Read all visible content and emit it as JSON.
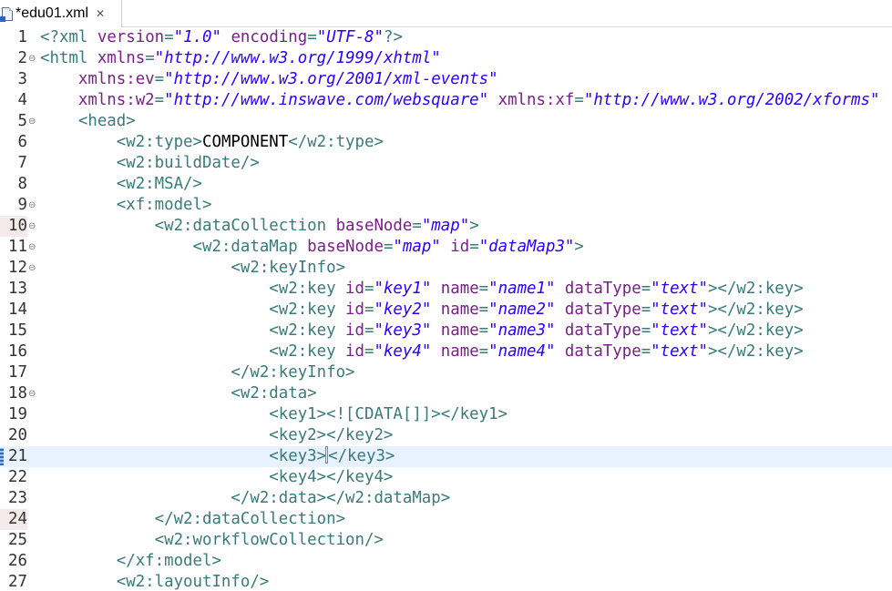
{
  "tab": {
    "title": "*edu01.xml",
    "close_glyph": "✕",
    "icon": "xml-file-icon"
  },
  "editor": {
    "current_line": 21,
    "lines": [
      {
        "n": "1",
        "fold": "",
        "parts": [
          [
            "t",
            "<?"
          ],
          [
            "t",
            "xml "
          ],
          [
            "a",
            "version"
          ],
          [
            "p",
            "="
          ],
          [
            "v",
            "\"1.0\""
          ],
          [
            "a",
            " encoding"
          ],
          [
            "p",
            "="
          ],
          [
            "v",
            "\"UTF-8\""
          ],
          [
            "t",
            "?>"
          ]
        ]
      },
      {
        "n": "2",
        "fold": "⊖",
        "parts": [
          [
            "t",
            "<html "
          ],
          [
            "a",
            "xmlns"
          ],
          [
            "p",
            "="
          ],
          [
            "v",
            "\"http://www.w3.org/1999/xhtml\""
          ]
        ]
      },
      {
        "n": "3",
        "fold": "",
        "parts": [
          [
            "x",
            "    "
          ],
          [
            "a",
            "xmlns:ev"
          ],
          [
            "p",
            "="
          ],
          [
            "v",
            "\"http://www.w3.org/2001/xml-events\""
          ]
        ]
      },
      {
        "n": "4",
        "fold": "",
        "parts": [
          [
            "x",
            "    "
          ],
          [
            "a",
            "xmlns:w2"
          ],
          [
            "p",
            "="
          ],
          [
            "v",
            "\"http://www.inswave.com/websquare\""
          ],
          [
            "a",
            " xmlns:xf"
          ],
          [
            "p",
            "="
          ],
          [
            "v",
            "\"http://www.w3.org/2002/xforms\""
          ]
        ]
      },
      {
        "n": "5",
        "fold": "⊖",
        "parts": [
          [
            "x",
            "    "
          ],
          [
            "t",
            "<head>"
          ]
        ]
      },
      {
        "n": "6",
        "fold": "",
        "parts": [
          [
            "x",
            "        "
          ],
          [
            "t",
            "<w2:type>"
          ],
          [
            "x",
            "COMPONENT"
          ],
          [
            "t",
            "</w2:type>"
          ]
        ]
      },
      {
        "n": "7",
        "fold": "",
        "parts": [
          [
            "x",
            "        "
          ],
          [
            "t",
            "<w2:buildDate/>"
          ]
        ]
      },
      {
        "n": "8",
        "fold": "",
        "parts": [
          [
            "x",
            "        "
          ],
          [
            "t",
            "<w2:MSA/>"
          ]
        ]
      },
      {
        "n": "9",
        "fold": "⊖",
        "parts": [
          [
            "x",
            "        "
          ],
          [
            "t",
            "<xf:model>"
          ]
        ]
      },
      {
        "n": "10",
        "fold": "⊖",
        "err": true,
        "parts": [
          [
            "x",
            "            "
          ],
          [
            "t",
            "<w2:dataCollection "
          ],
          [
            "a",
            "baseNode"
          ],
          [
            "p",
            "="
          ],
          [
            "v",
            "\"map\""
          ],
          [
            "t",
            ">"
          ]
        ]
      },
      {
        "n": "11",
        "fold": "⊖",
        "parts": [
          [
            "x",
            "                "
          ],
          [
            "t",
            "<w2:dataMap "
          ],
          [
            "a",
            "baseNode"
          ],
          [
            "p",
            "="
          ],
          [
            "v",
            "\"map\""
          ],
          [
            "a",
            " id"
          ],
          [
            "p",
            "="
          ],
          [
            "v",
            "\"dataMap3\""
          ],
          [
            "t",
            ">"
          ]
        ]
      },
      {
        "n": "12",
        "fold": "⊖",
        "parts": [
          [
            "x",
            "                    "
          ],
          [
            "t",
            "<w2:keyInfo>"
          ]
        ]
      },
      {
        "n": "13",
        "fold": "",
        "parts": [
          [
            "x",
            "                        "
          ],
          [
            "t",
            "<w2:key "
          ],
          [
            "a",
            "id"
          ],
          [
            "p",
            "="
          ],
          [
            "v",
            "\"key1\""
          ],
          [
            "a",
            " name"
          ],
          [
            "p",
            "="
          ],
          [
            "v",
            "\"name1\""
          ],
          [
            "a",
            " dataType"
          ],
          [
            "p",
            "="
          ],
          [
            "v",
            "\"text\""
          ],
          [
            "t",
            "></w2:key>"
          ]
        ]
      },
      {
        "n": "14",
        "fold": "",
        "parts": [
          [
            "x",
            "                        "
          ],
          [
            "t",
            "<w2:key "
          ],
          [
            "a",
            "id"
          ],
          [
            "p",
            "="
          ],
          [
            "v",
            "\"key2\""
          ],
          [
            "a",
            " name"
          ],
          [
            "p",
            "="
          ],
          [
            "v",
            "\"name2\""
          ],
          [
            "a",
            " dataType"
          ],
          [
            "p",
            "="
          ],
          [
            "v",
            "\"text\""
          ],
          [
            "t",
            "></w2:key>"
          ]
        ]
      },
      {
        "n": "15",
        "fold": "",
        "parts": [
          [
            "x",
            "                        "
          ],
          [
            "t",
            "<w2:key "
          ],
          [
            "a",
            "id"
          ],
          [
            "p",
            "="
          ],
          [
            "v",
            "\"key3\""
          ],
          [
            "a",
            " name"
          ],
          [
            "p",
            "="
          ],
          [
            "v",
            "\"name3\""
          ],
          [
            "a",
            " dataType"
          ],
          [
            "p",
            "="
          ],
          [
            "v",
            "\"text\""
          ],
          [
            "t",
            "></w2:key>"
          ]
        ]
      },
      {
        "n": "16",
        "fold": "",
        "parts": [
          [
            "x",
            "                        "
          ],
          [
            "t",
            "<w2:key "
          ],
          [
            "a",
            "id"
          ],
          [
            "p",
            "="
          ],
          [
            "v",
            "\"key4\""
          ],
          [
            "a",
            " name"
          ],
          [
            "p",
            "="
          ],
          [
            "v",
            "\"name4\""
          ],
          [
            "a",
            " dataType"
          ],
          [
            "p",
            "="
          ],
          [
            "v",
            "\"text\""
          ],
          [
            "t",
            "></w2:key>"
          ]
        ]
      },
      {
        "n": "17",
        "fold": "",
        "parts": [
          [
            "x",
            "                    "
          ],
          [
            "t",
            "</w2:keyInfo>"
          ]
        ]
      },
      {
        "n": "18",
        "fold": "⊖",
        "parts": [
          [
            "x",
            "                    "
          ],
          [
            "t",
            "<w2:data>"
          ]
        ]
      },
      {
        "n": "19",
        "fold": "",
        "parts": [
          [
            "x",
            "                        "
          ],
          [
            "t",
            "<key1><![CDATA[]]></key1>"
          ]
        ]
      },
      {
        "n": "20",
        "fold": "",
        "parts": [
          [
            "x",
            "                        "
          ],
          [
            "t",
            "<key2></key2>"
          ]
        ]
      },
      {
        "n": "21",
        "fold": "",
        "parts": [
          [
            "x",
            "                        "
          ],
          [
            "t",
            "<key3>"
          ],
          [
            "cursor",
            ""
          ],
          [
            "t",
            "</key3>"
          ]
        ]
      },
      {
        "n": "22",
        "fold": "",
        "parts": [
          [
            "x",
            "                        "
          ],
          [
            "t",
            "<key4></key4>"
          ]
        ]
      },
      {
        "n": "23",
        "fold": "",
        "parts": [
          [
            "x",
            "                    "
          ],
          [
            "t",
            "</w2:data></w2:dataMap>"
          ]
        ]
      },
      {
        "n": "24",
        "fold": "",
        "err": true,
        "parts": [
          [
            "x",
            "            "
          ],
          [
            "t",
            "</w2:dataCollection>"
          ]
        ]
      },
      {
        "n": "25",
        "fold": "",
        "parts": [
          [
            "x",
            "            "
          ],
          [
            "t",
            "<w2:workflowCollection/>"
          ]
        ]
      },
      {
        "n": "26",
        "fold": "",
        "parts": [
          [
            "x",
            "        "
          ],
          [
            "t",
            "</xf:model>"
          ]
        ]
      },
      {
        "n": "27",
        "fold": "",
        "parts": [
          [
            "x",
            "        "
          ],
          [
            "t",
            "<w2:layoutInfo/>"
          ]
        ]
      }
    ]
  }
}
